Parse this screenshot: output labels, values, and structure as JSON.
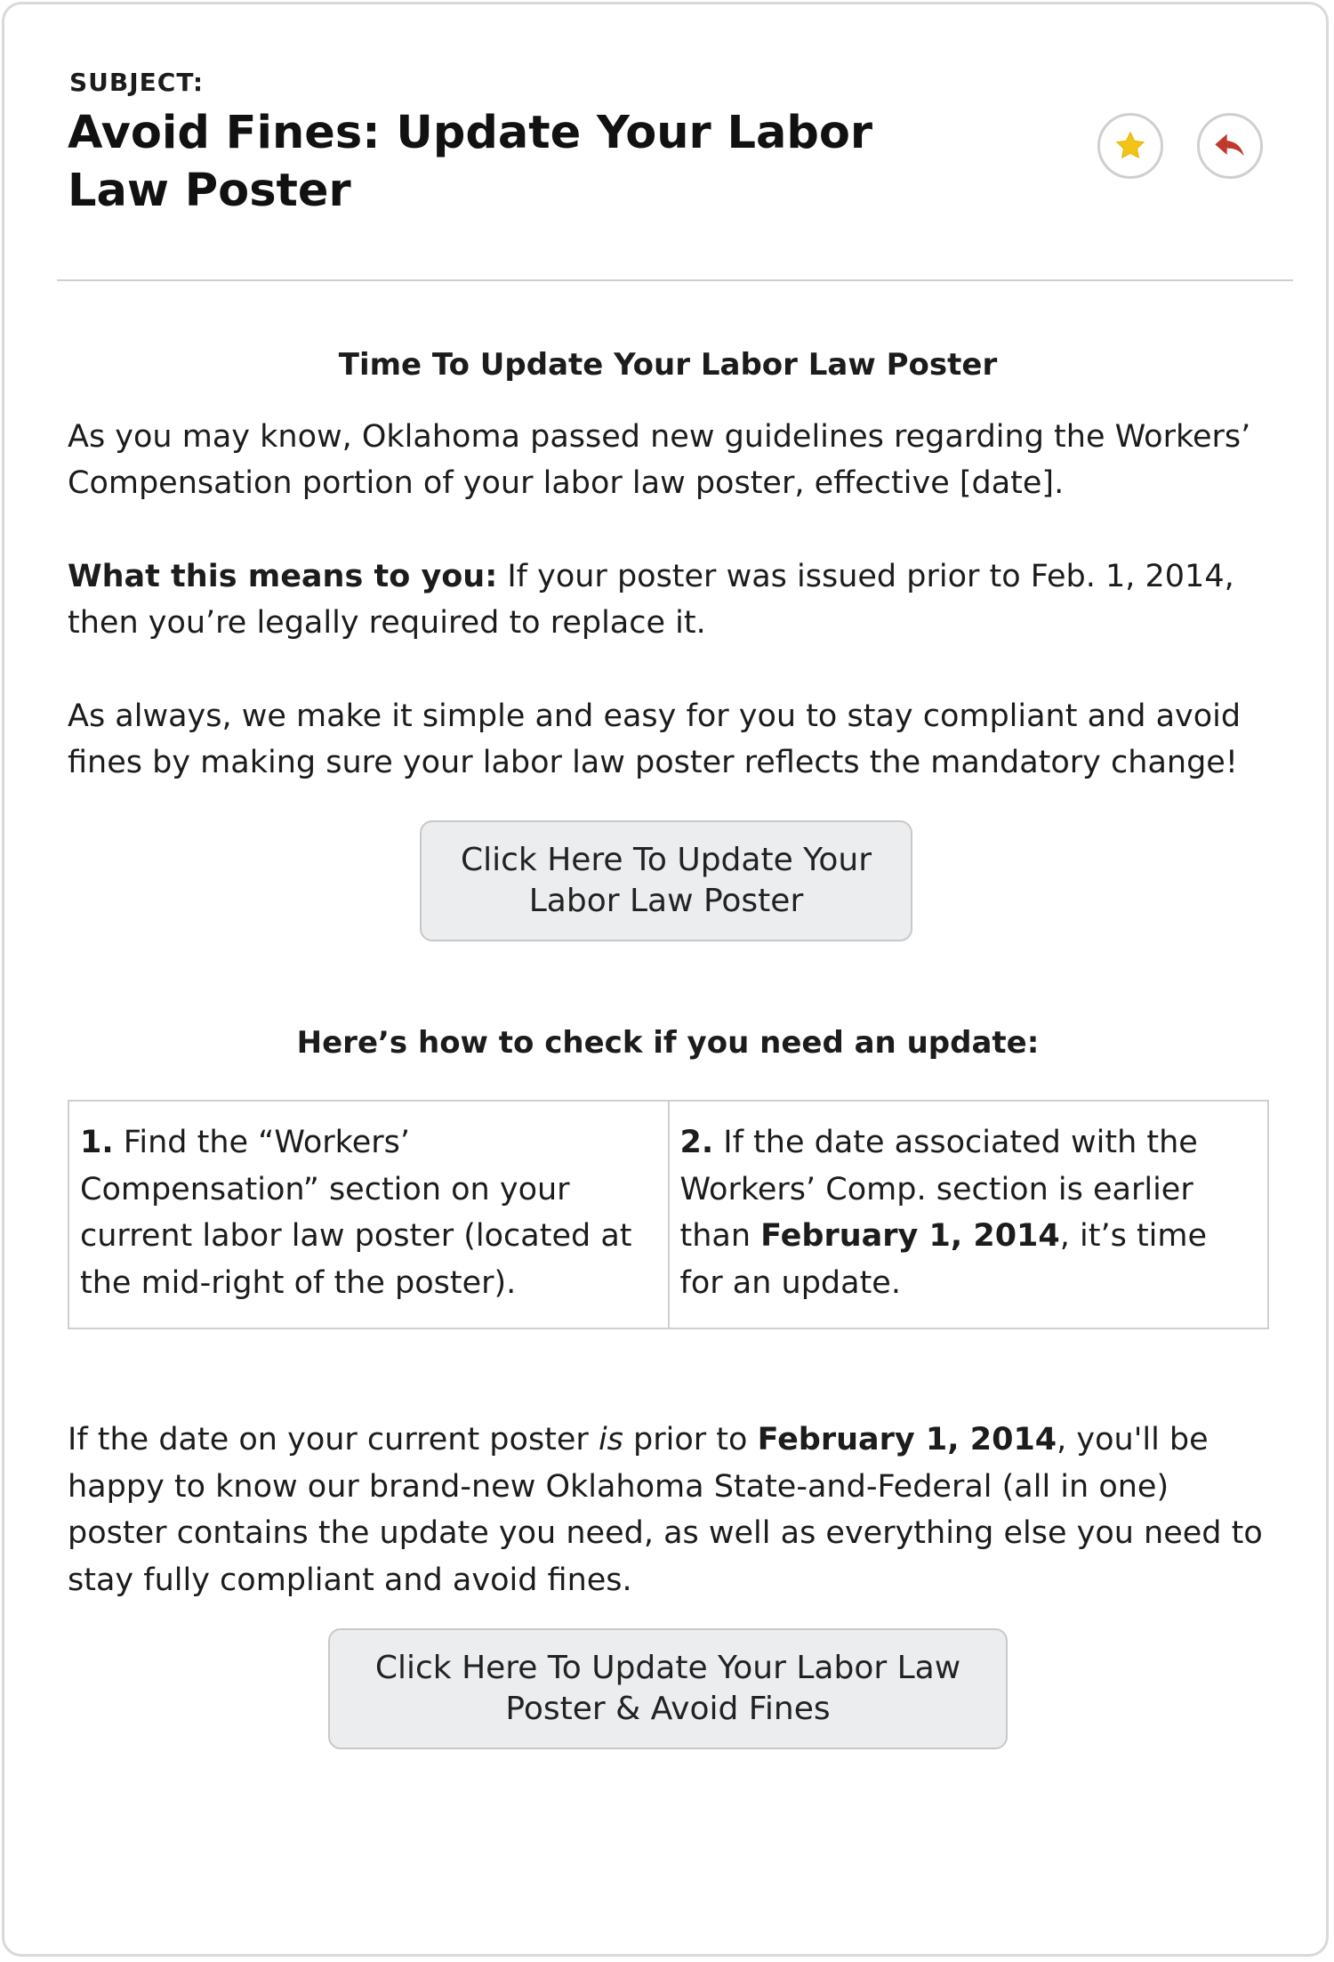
{
  "email": {
    "subject_label": "SUBJECT:",
    "subject": "Avoid Fines: Update Your Labor Law Poster",
    "actions": {
      "star": {
        "icon": "star-icon",
        "color": "#f2c416"
      },
      "reply": {
        "icon": "reply-arrow-icon",
        "color": "#c0392b"
      }
    }
  },
  "content": {
    "heading": "Time To Update Your Labor Law Poster",
    "intro": "As you may know, Oklahoma passed new guidelines regarding the Workers’ Compensation portion of your labor law poster, effective [date].",
    "means_label": "What this means to you:",
    "means_text": " If your poster was issued prior to Feb. 1, 2014, then you’re legally required to replace it.",
    "always": "As always, we make it simple and easy for you to stay compliant and avoid fines by making sure your labor law poster reflects the mandatory change!",
    "cta1": "Click Here To Update Your Labor Law Poster",
    "check_heading": "Here’s how to check if you need an update:",
    "steps": [
      {
        "num": "1.",
        "text": " Find the “Workers’ Compensation” section on your current labor law poster (located at the mid-right of the poster)."
      },
      {
        "num": "2.",
        "text_before": " If the date associated with the Workers’ Comp. section is earlier than ",
        "date": "February 1, 2014",
        "text_after": ", it’s time for an update."
      }
    ],
    "final": {
      "part1": "If the date on your current poster ",
      "italic": "is",
      "part2": " prior to ",
      "date": "February 1, 2014",
      "part3": ", you'll be happy to know our brand-new Oklahoma State-and-Federal (all in one) poster contains the update you need, as well as everything else you need to stay fully compliant and avoid fines."
    },
    "cta2": "Click Here To Update Your Labor Law Poster & Avoid Fines"
  }
}
